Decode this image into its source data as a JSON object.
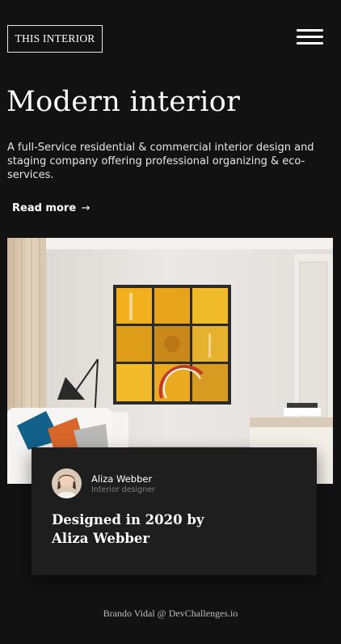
{
  "header": {
    "logo_text": "THIS INTERIOR",
    "menu_icon": "hamburger-menu-icon"
  },
  "hero": {
    "title": "Modern interior",
    "description": "A full-Service residential & commercial interior design and staging company offering professional organizing & eco-services.",
    "read_more_label": "Read more",
    "read_more_arrow": "→"
  },
  "card": {
    "author_name": "Aliza Webber",
    "author_role": "Interior designer",
    "title": "Designed in 2020 by Aliza Webber"
  },
  "footer": {
    "credit": "Brando Vidal @ DevChallenges.io"
  },
  "colors": {
    "background": "#121212",
    "card_background": "#1e1e1e",
    "text": "#ffffff",
    "muted_text": "#7d7d7d"
  }
}
